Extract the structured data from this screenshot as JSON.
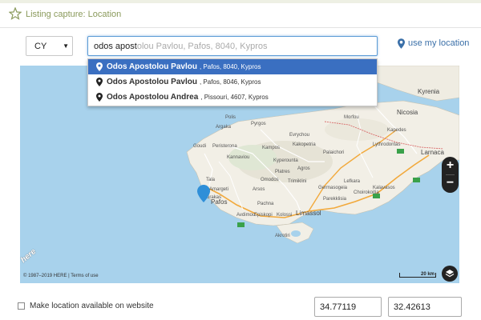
{
  "header": {
    "title": "Listing capture: Location",
    "star_icon": "star-outline-icon",
    "accent": "#8a9a5b"
  },
  "country_select": {
    "selected": "CY",
    "caret_icon": "caret-down-icon"
  },
  "search": {
    "typed_value": "odos apost",
    "autocomplete_hint": "olou Pavlou, Pafos, 8040, Kypros"
  },
  "use_location": {
    "label": "use my location",
    "icon": "location-pin-icon",
    "color": "#3a6fa8"
  },
  "suggestions": [
    {
      "street": "Odos Apostolou Pavlou",
      "detail": ", Pafos, 8040, Kypros",
      "active": true
    },
    {
      "street": "Odos Apostolou Pavlou",
      "detail": ", Pafos, 8046, Kypros",
      "active": false
    },
    {
      "street": "Odos Apostolou Andrea",
      "detail": ", Pissouri, 4607, Kypros",
      "active": false
    }
  ],
  "map": {
    "zoom_in": "+",
    "zoom_out": "−",
    "brand": "here",
    "copyright": "© 1987–2019 HERE | ",
    "terms": "Terms of use",
    "scale": "20 km",
    "sea_color": "#a8d2ec",
    "land_color": "#f2efe6",
    "labels": {
      "polis": "Polis",
      "argaka": "Argaka",
      "pyrgos": "Pyrgos",
      "goudi": "Goudi",
      "peristerona": "Peristerona",
      "kannaviou": "Kannaviou",
      "tala": "Tala",
      "amargeti": "Amargeti",
      "pafos": "Pafos",
      "chlorakas": "Chlorakas",
      "arsos": "Arsos",
      "omodos": "Omodos",
      "trimiklini": "Trimiklini",
      "platres": "Platres",
      "kakopetria": "Kakopetria",
      "evrychou": "Evrychou",
      "kampos": "Kampos",
      "agros": "Agros",
      "palaichori": "Palaichori",
      "kyperounta": "Kyperounta",
      "pachna": "Pachna",
      "avdimou": "Avdimou",
      "kolossi": "Kolossi",
      "limassol": "Limassol",
      "akrotiri": "Akrotiri",
      "kyrenia": "Kyrenia",
      "nicosia": "Nicosia",
      "morfou": "Morfou",
      "lythrodontas": "Lythrodontas",
      "kapedes": "Kapedes",
      "kalavasos": "Kalavasos",
      "choirokoitia": "Choirokoitia",
      "parekklisia": "Parekklisia",
      "germasogeia": "Germasogeia",
      "larnaca": "Larnaca",
      "episkopi": "Episkopi",
      "lefkara": "Lefkara"
    }
  },
  "footer": {
    "checkbox_label": "Make location available on website",
    "latitude": "34.77119",
    "longitude": "32.42613"
  }
}
